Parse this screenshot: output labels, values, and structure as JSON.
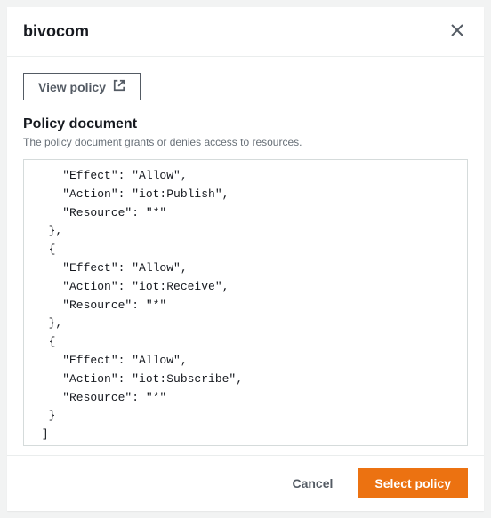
{
  "header": {
    "title": "bivocom"
  },
  "actions": {
    "view_policy_label": "View policy"
  },
  "section": {
    "title": "Policy document",
    "description": "The policy document grants or denies access to resources."
  },
  "policy_code": "    \"Effect\": \"Allow\",\n    \"Action\": \"iot:Publish\",\n    \"Resource\": \"*\"\n  },\n  {\n    \"Effect\": \"Allow\",\n    \"Action\": \"iot:Receive\",\n    \"Resource\": \"*\"\n  },\n  {\n    \"Effect\": \"Allow\",\n    \"Action\": \"iot:Subscribe\",\n    \"Resource\": \"*\"\n  }\n ]\n}",
  "footer": {
    "cancel_label": "Cancel",
    "select_label": "Select policy"
  }
}
